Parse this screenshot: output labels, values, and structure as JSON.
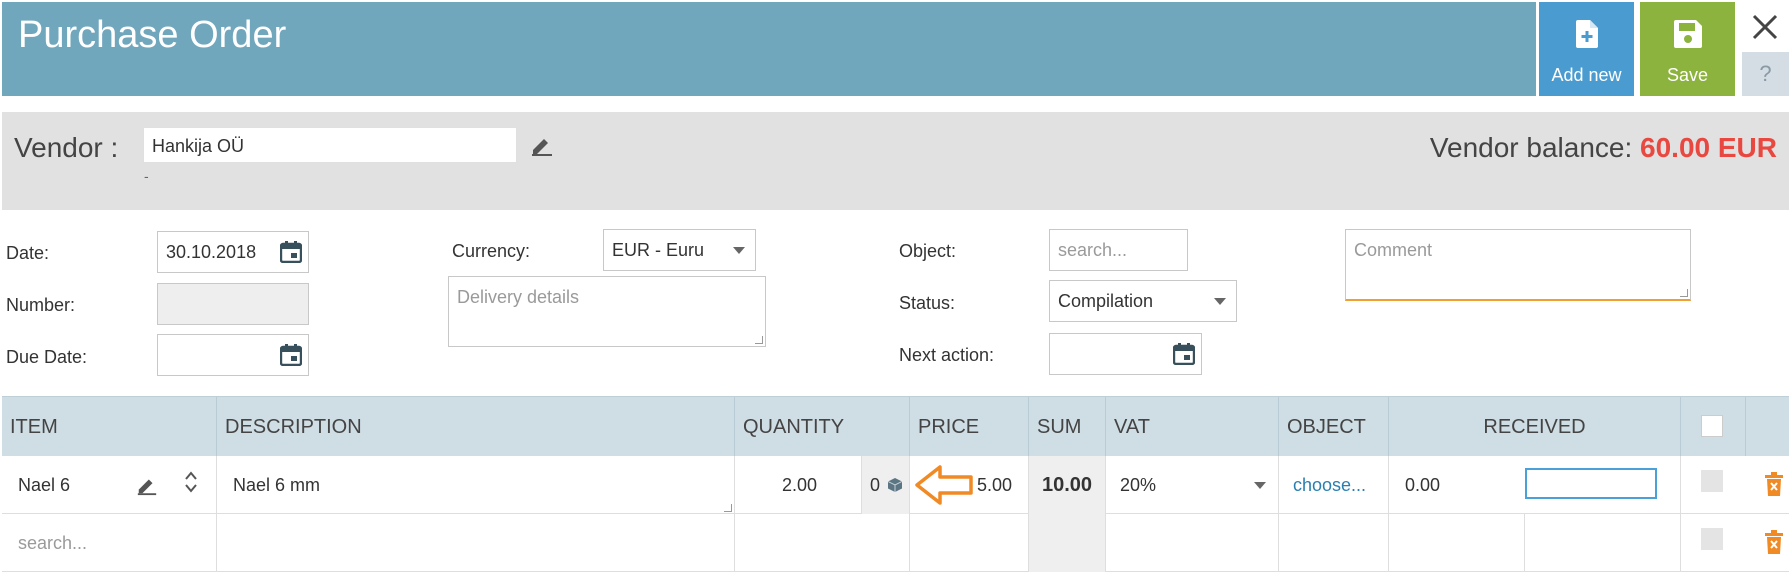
{
  "header": {
    "title": "Purchase Order",
    "add_new_label": "Add new",
    "save_label": "Save",
    "help_label": "?"
  },
  "vendor": {
    "label": "Vendor :",
    "value": "Hankija OÜ",
    "sub": "-",
    "balance_label": "Vendor balance:",
    "balance_value": "60.00 EUR"
  },
  "form": {
    "date_label": "Date:",
    "date_value": "30.10.2018",
    "number_label": "Number:",
    "number_value": "",
    "due_label": "Due Date:",
    "due_value": "",
    "currency_label": "Currency:",
    "currency_value": "EUR - Euru",
    "delivery_placeholder": "Delivery details",
    "object_label": "Object:",
    "object_placeholder": "search...",
    "status_label": "Status:",
    "status_value": "Compilation",
    "next_action_label": "Next action:",
    "next_action_value": "",
    "comment_placeholder": "Comment"
  },
  "table": {
    "columns": [
      "ITEM",
      "DESCRIPTION",
      "QUANTITY",
      "PRICE",
      "SUM",
      "VAT",
      "OBJECT",
      "RECEIVED"
    ],
    "rows": [
      {
        "item": "Nael 6",
        "description": "Nael 6 mm",
        "quantity": "2.00",
        "stock": "0",
        "price": "5.00",
        "sum": "10.00",
        "vat": "20%",
        "object": "choose...",
        "received": "0.00"
      }
    ],
    "new_row_placeholder": "search..."
  },
  "colors": {
    "header_bg": "#71a7bd",
    "add_new_bg": "#4a9bcf",
    "save_bg": "#8db33f",
    "balance_accent": "#e8483f",
    "arrow_accent": "#f08a24",
    "delete_accent": "#f08a24"
  },
  "icons": {
    "add_new": "file-plus-icon",
    "save": "floppy-disk-icon",
    "close": "close-icon",
    "help": "question-icon",
    "edit": "pencil-icon",
    "calendar": "calendar-icon",
    "sort": "sort-icon",
    "stock": "box-icon",
    "annotation": "arrow-left-icon",
    "delete": "trash-icon"
  }
}
